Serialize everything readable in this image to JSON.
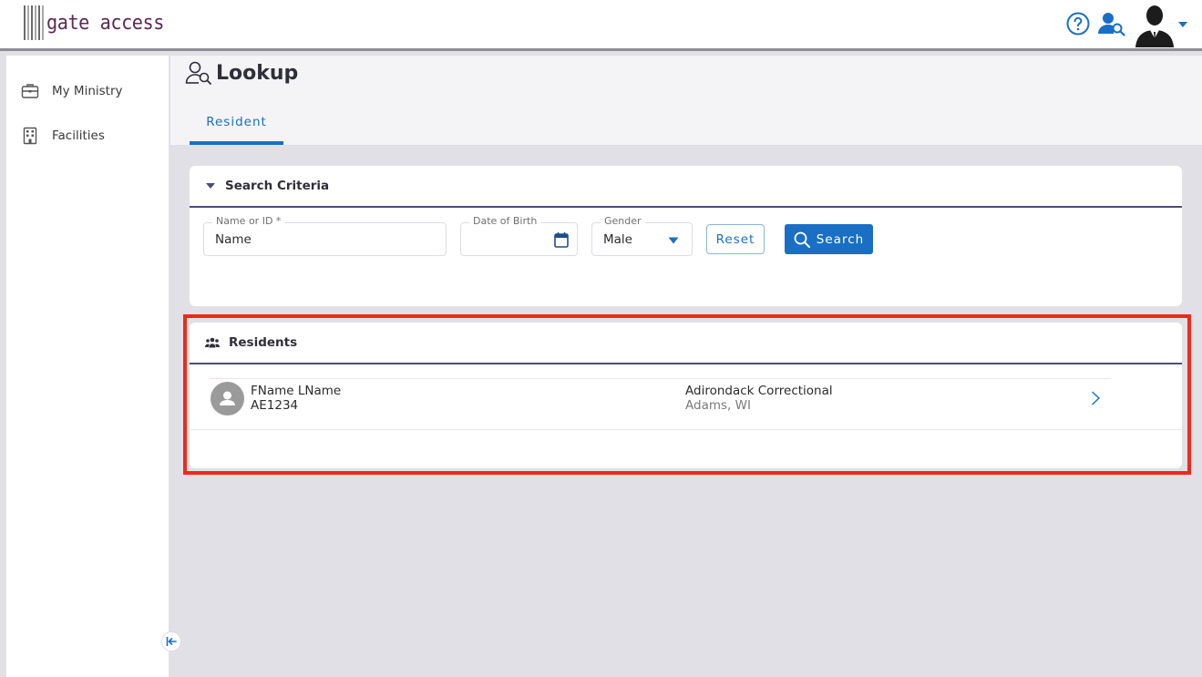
{
  "app": {
    "logo_text": "gate access"
  },
  "sidebar": {
    "items": [
      {
        "label": "My Ministry",
        "icon": "briefcase-icon"
      },
      {
        "label": "Facilities",
        "icon": "building-icon"
      }
    ]
  },
  "page": {
    "title": "Lookup",
    "tabs": [
      {
        "label": "Resident",
        "active": true
      }
    ]
  },
  "search": {
    "title": "Search Criteria",
    "name_field": {
      "label": "Name or ID *",
      "value": "Name"
    },
    "dob_field": {
      "label": "Date of Birth",
      "value": ""
    },
    "gender_field": {
      "label": "Gender",
      "value": "Male"
    },
    "reset_label": "Reset",
    "search_label": "Search"
  },
  "results": {
    "title": "Residents",
    "rows": [
      {
        "name": "FName LName",
        "id": "AE1234",
        "facility": "Adirondack Correctional",
        "location": "Adams, WI"
      }
    ]
  },
  "colors": {
    "accent": "#1a6fc4",
    "brand": "#5c2a55",
    "highlight": "#f0291a",
    "divider": "#4a4e7a"
  }
}
